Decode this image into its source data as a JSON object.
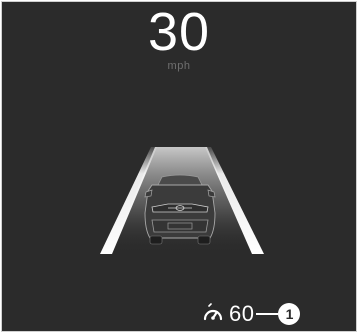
{
  "display": {
    "speed": "30",
    "unit": "mph"
  },
  "cruise": {
    "icon": "cruise-control-speedometer-icon",
    "set_speed": "60"
  },
  "callout": {
    "number": "1"
  },
  "colors": {
    "background": "#2b2b2b",
    "text": "#ffffff",
    "unit_text": "#6f6f6f",
    "lane_lines": "#ffffff",
    "vehicle": "#3a3a3a"
  }
}
